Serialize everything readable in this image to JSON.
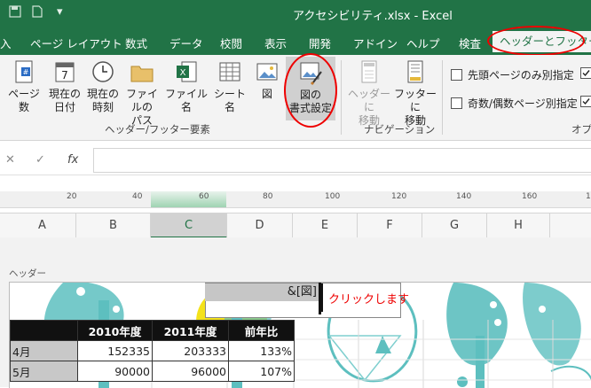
{
  "window": {
    "title": "アクセシビリティ.xlsx  -  Excel",
    "qat_arrow": "▾"
  },
  "tabs": [
    {
      "label": "入"
    },
    {
      "label": "ページ レイアウト"
    },
    {
      "label": "数式"
    },
    {
      "label": "データ"
    },
    {
      "label": "校閲"
    },
    {
      "label": "表示"
    },
    {
      "label": "開発"
    },
    {
      "label": "アドイン"
    },
    {
      "label": "ヘルプ"
    },
    {
      "label": "検査"
    },
    {
      "label": "ヘッダーとフッター"
    }
  ],
  "ribbon": {
    "elements_group": {
      "label": "ヘッダー/フッター要素",
      "buttons": [
        {
          "line1": "ページ数",
          "line2": ""
        },
        {
          "line1": "現在の",
          "line2": "日付"
        },
        {
          "line1": "現在の",
          "line2": "時刻"
        },
        {
          "line1": "ファイルの",
          "line2": "パス"
        },
        {
          "line1": "ファイル名",
          "line2": ""
        },
        {
          "line1": "シート名",
          "line2": ""
        },
        {
          "line1": "図",
          "line2": ""
        },
        {
          "line1": "図の",
          "line2": "書式設定"
        }
      ]
    },
    "navigation_group": {
      "label": "ナビゲーション",
      "buttons": [
        {
          "line1": "ヘッダーに",
          "line2": "移動"
        },
        {
          "line1": "フッターに",
          "line2": "移動"
        }
      ]
    },
    "options_group": {
      "label": "オプ",
      "checkboxes": [
        {
          "label": "先頭ページのみ別指定",
          "checked": false
        },
        {
          "label": "奇数/偶数ページ別指定",
          "checked": false
        }
      ]
    }
  },
  "formula_bar": {
    "cancel": "✕",
    "enter": "✓",
    "fx": "fx",
    "value": ""
  },
  "ruler": {
    "numbers": [
      "20",
      "40",
      "60",
      "80",
      "100",
      "120",
      "140",
      "160",
      "180"
    ]
  },
  "columns": [
    "A",
    "B",
    "C",
    "D",
    "E",
    "F",
    "G",
    "H"
  ],
  "header_area": {
    "label": "ヘッダー",
    "code": "&[図]",
    "callout": "クリックします"
  },
  "table": {
    "headers": [
      "",
      "2010年度",
      "2011年度",
      "前年比"
    ],
    "rows": [
      [
        "4月",
        "152335",
        "203333",
        "133%"
      ],
      [
        "5月",
        "90000",
        "96000",
        "107%"
      ]
    ]
  },
  "colors": {
    "excel_green": "#217346",
    "highlight_red": "#e00000",
    "tree_teal": "#5dbfbf"
  }
}
